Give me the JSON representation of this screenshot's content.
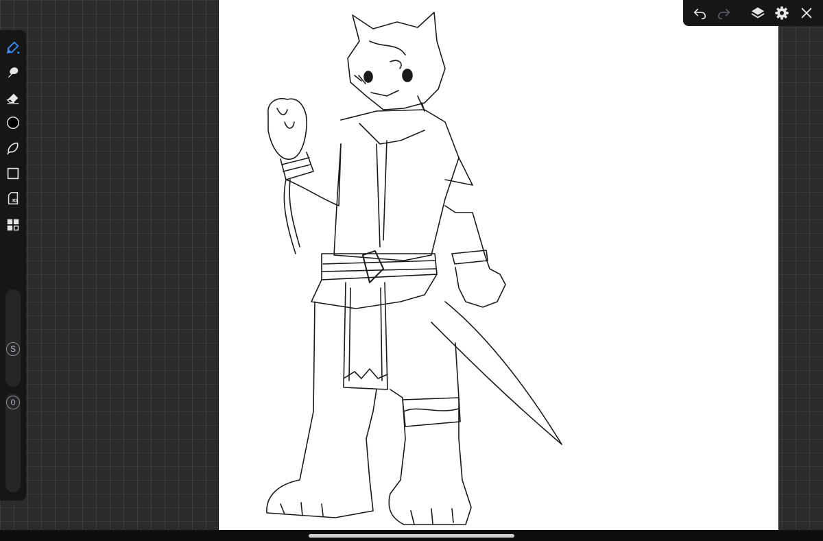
{
  "colors": {
    "workspace_bg": "#2b2b2e",
    "toolbar_bg": "#161618",
    "active_tool": "#3a8df0",
    "icon": "#e6e6e6",
    "icon_disabled": "#5e5e62",
    "canvas": "#ffffff"
  },
  "left_toolbar": {
    "tools": [
      {
        "name": "brush",
        "icon": "brush-pen-icon",
        "active": true
      },
      {
        "name": "smudge",
        "icon": "smudge-icon",
        "active": false
      },
      {
        "name": "eraser",
        "icon": "eraser-icon",
        "active": false
      },
      {
        "name": "color",
        "icon": "color-swatch-icon",
        "value": "#000000",
        "active": false
      },
      {
        "name": "lasso",
        "icon": "lasso-icon",
        "active": false
      },
      {
        "name": "shape",
        "icon": "rectangle-icon",
        "active": false
      },
      {
        "name": "3d",
        "icon": "3d-model-icon",
        "label": "3D",
        "active": false
      },
      {
        "name": "gallery",
        "icon": "grid-icon",
        "active": false
      }
    ],
    "size_slider": {
      "knob_label": "S",
      "value": 0.15
    },
    "opacity_slider": {
      "knob_label": "0",
      "value": 0.0
    }
  },
  "top_toolbar": {
    "buttons": [
      {
        "name": "undo",
        "icon": "undo-icon",
        "enabled": true
      },
      {
        "name": "redo",
        "icon": "redo-icon",
        "enabled": false
      },
      {
        "name": "layers",
        "icon": "layers-icon",
        "enabled": true
      },
      {
        "name": "settings",
        "icon": "gear-icon",
        "enabled": true
      },
      {
        "name": "close",
        "icon": "close-icon",
        "enabled": true
      }
    ]
  },
  "canvas": {
    "subject": "line-art"
  }
}
